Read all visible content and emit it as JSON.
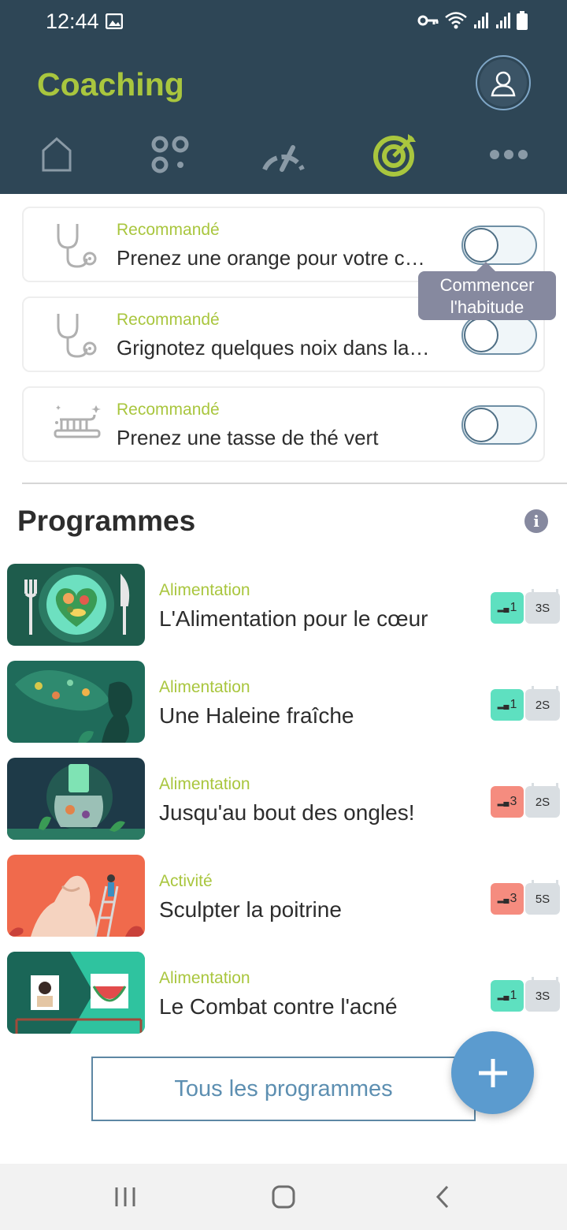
{
  "status_bar": {
    "time": "12:44"
  },
  "header": {
    "title": "Coaching"
  },
  "nav_tabs": [
    {
      "name": "home",
      "icon": "home-icon"
    },
    {
      "name": "apps",
      "icon": "grid-dots-icon"
    },
    {
      "name": "gauge",
      "icon": "gauge-icon"
    },
    {
      "name": "coaching",
      "icon": "target-icon",
      "active": true
    },
    {
      "name": "more",
      "icon": "more-dots-icon"
    }
  ],
  "habits": [
    {
      "tag": "Recommandé",
      "title": "Prenez une orange pour votre collation",
      "icon": "stethoscope-icon",
      "enabled": false
    },
    {
      "tag": "Recommandé",
      "title": "Grignotez quelques noix dans la journée",
      "icon": "stethoscope-icon",
      "enabled": false
    },
    {
      "tag": "Recommandé",
      "title": "Prenez une tasse de thé vert",
      "icon": "toothbrush-icon",
      "enabled": false
    }
  ],
  "tooltip": {
    "line1": "Commencer",
    "line2": "l'habitude"
  },
  "programs_section": {
    "title": "Programmes"
  },
  "programs": [
    {
      "category": "Alimentation",
      "title": "L'Alimentation pour le cœur",
      "level": "1",
      "duration": "3S",
      "level_color": "#5ee0c0"
    },
    {
      "category": "Alimentation",
      "title": "Une Haleine fraîche",
      "level": "1",
      "duration": "2S",
      "level_color": "#5ee0c0"
    },
    {
      "category": "Alimentation",
      "title": "Jusqu'au bout des ongles!",
      "level": "3",
      "duration": "2S",
      "level_color": "#f58c7f"
    },
    {
      "category": "Activité",
      "title": "Sculpter la poitrine",
      "level": "3",
      "duration": "5S",
      "level_color": "#f58c7f"
    },
    {
      "category": "Alimentation",
      "title": "Le Combat contre l'acné",
      "level": "1",
      "duration": "3S",
      "level_color": "#5ee0c0"
    }
  ],
  "all_programs_button": "Tous les programmes",
  "colors": {
    "header_bg": "#2e4656",
    "accent_green": "#a9c63e",
    "fab_blue": "#5b9bcf"
  }
}
